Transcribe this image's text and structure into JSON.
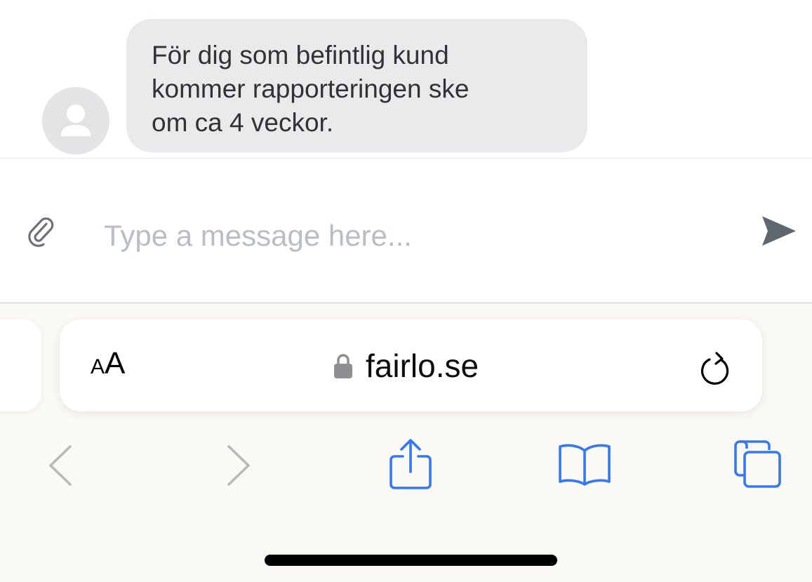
{
  "chat": {
    "message_text": "För dig som befintlig kund\nkommer rapporteringen ske\nom ca 4 veckor.",
    "avatar_icon": "user-silhouette-icon"
  },
  "composer": {
    "placeholder": "Type a message here...",
    "value": "",
    "attach_icon": "paperclip-icon",
    "send_icon": "paper-plane-send-icon"
  },
  "browser": {
    "text_size_small": "A",
    "text_size_large": "A",
    "lock_icon": "lock-icon",
    "url": "fairlo.se",
    "reload_icon": "reload-icon",
    "toolbar_icons": [
      "back-chevron-icon",
      "forward-chevron-icon",
      "share-icon",
      "bookmarks-book-icon",
      "tabs-icon"
    ]
  },
  "colors": {
    "bubble": "#e9eaec",
    "bubble_text": "#2f3337",
    "placeholder": "#b9bec4",
    "send_icon": "#5f666d",
    "safari_blue": "#3478f6",
    "disabled_gray": "#b9b9b9",
    "toolbar_bg": "#fbf9f4"
  }
}
